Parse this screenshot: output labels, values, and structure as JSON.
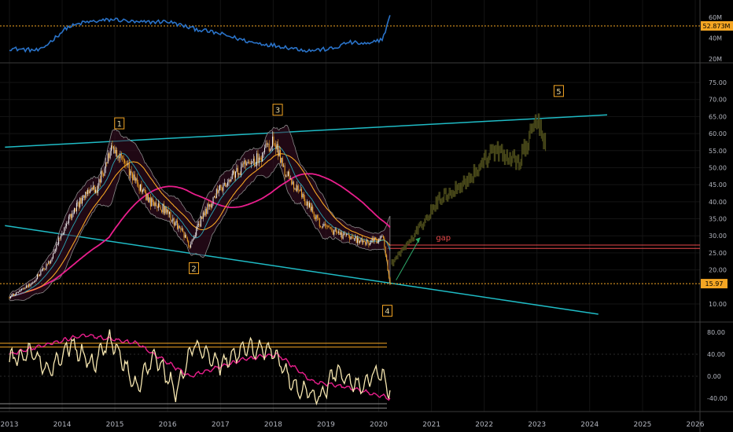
{
  "colors": {
    "background": "#000000",
    "grid": "#141414",
    "axis_text": "#b2b5be",
    "channel": "#1fbcc6",
    "volume": "#2a73c9",
    "candle_up": "#f0f0f0",
    "candle_down": "#f5a623",
    "ma_pink": "#e91e8c",
    "ma_orange": "#f5a623",
    "projection": "#4a4a1a",
    "price_badge": "#f5a623",
    "gap": "#e8494a",
    "rsi_fast": "#f7e7b0",
    "rsi_slow": "#e91e8c",
    "orange_level": "#f5a623"
  },
  "volume_panel": {
    "label_top": "60M",
    "label_mid": "40M",
    "label_low": "20M",
    "badge": "52.873M"
  },
  "price_badge": "15.97",
  "gap_label": "gap",
  "wave_labels": [
    "1",
    "2",
    "3",
    "4",
    "5"
  ],
  "chart_data": {
    "type": "candlestick",
    "x_axis": {
      "type": "date",
      "ticks": [
        "2013",
        "2014",
        "2015",
        "2016",
        "2017",
        "2018",
        "2019",
        "2020",
        "2021",
        "2022",
        "2023",
        "2024",
        "2025",
        "2026"
      ],
      "range": [
        "2013-01-01",
        "2026-01-01"
      ]
    },
    "y_axis": {
      "ticks": [
        "75.00",
        "70.00",
        "65.00",
        "60.00",
        "55.00",
        "50.00",
        "45.00",
        "40.00",
        "35.00",
        "30.00",
        "25.00",
        "20.00",
        "10.00"
      ],
      "range": [
        5,
        77
      ]
    },
    "price_path": [
      [
        "2013-01-01",
        12
      ],
      [
        "2013-06-01",
        16
      ],
      [
        "2013-10-01",
        22
      ],
      [
        "2014-02-01",
        34
      ],
      [
        "2014-06-01",
        42
      ],
      [
        "2014-09-01",
        44
      ],
      [
        "2014-12-01",
        55
      ],
      [
        "2015-03-01",
        52
      ],
      [
        "2015-06-01",
        46
      ],
      [
        "2015-09-01",
        40
      ],
      [
        "2015-12-01",
        38
      ],
      [
        "2016-04-01",
        32
      ],
      [
        "2016-06-01",
        27
      ],
      [
        "2016-09-01",
        36
      ],
      [
        "2017-01-01",
        44
      ],
      [
        "2017-06-01",
        50
      ],
      [
        "2017-10-01",
        53
      ],
      [
        "2018-01-01",
        58
      ],
      [
        "2018-04-01",
        48
      ],
      [
        "2018-08-01",
        41
      ],
      [
        "2018-12-01",
        33
      ],
      [
        "2019-05-01",
        30
      ],
      [
        "2019-10-01",
        28
      ],
      [
        "2020-02-01",
        29
      ],
      [
        "2020-03-20",
        15.97
      ]
    ],
    "projection_path": [
      [
        "2020-04-01",
        22
      ],
      [
        "2020-09-01",
        30
      ],
      [
        "2021-03-01",
        41
      ],
      [
        "2021-09-01",
        46
      ],
      [
        "2022-03-01",
        55
      ],
      [
        "2022-09-01",
        52
      ],
      [
        "2023-01-01",
        64
      ],
      [
        "2023-03-01",
        56
      ]
    ],
    "channel_upper": [
      [
        "2012-12-01",
        56
      ],
      [
        "2024-05-01",
        65.5
      ]
    ],
    "channel_lower": [
      [
        "2012-12-01",
        33
      ],
      [
        "2024-03-01",
        7
      ]
    ],
    "levels": [
      {
        "name": "gap_top",
        "value": 27.3
      },
      {
        "name": "gap_bottom",
        "value": 26.3
      },
      {
        "name": "low",
        "value": 15.97
      }
    ],
    "waves": [
      {
        "label": "1",
        "date": "2015-02-01",
        "value": 63
      },
      {
        "label": "2",
        "date": "2016-07-01",
        "value": 20.5
      },
      {
        "label": "3",
        "date": "2018-02-01",
        "value": 67
      },
      {
        "label": "4",
        "date": "2020-03-01",
        "value": 8
      },
      {
        "label": "5",
        "date": "2023-06-01",
        "value": 72.5
      }
    ],
    "volume": {
      "range": [
        15,
        65
      ],
      "path": [
        [
          "2013-01-01",
          30
        ],
        [
          "2013-08-01",
          28
        ],
        [
          "2014-02-01",
          50
        ],
        [
          "2014-06-01",
          55
        ],
        [
          "2015-01-01",
          58
        ],
        [
          "2015-06-01",
          55
        ],
        [
          "2016-01-01",
          56
        ],
        [
          "2016-06-01",
          50
        ],
        [
          "2017-01-01",
          44
        ],
        [
          "2017-08-01",
          36
        ],
        [
          "2018-03-01",
          32
        ],
        [
          "2018-09-01",
          28
        ],
        [
          "2019-03-01",
          30
        ],
        [
          "2019-06-01",
          36
        ],
        [
          "2019-11-01",
          34
        ],
        [
          "2020-02-01",
          40
        ],
        [
          "2020-03-20",
          62
        ]
      ]
    },
    "oscillator": {
      "ticks": [
        "80.00",
        "40.00",
        "0.00",
        "-40.00"
      ],
      "range": [
        -65,
        90
      ],
      "orange_levels": [
        60,
        53
      ],
      "grey_levels": [
        -50,
        -58
      ],
      "fast_path": [
        [
          "2013-01-01",
          30
        ],
        [
          "2013-06-01",
          45
        ],
        [
          "2013-10-01",
          10
        ],
        [
          "2014-03-01",
          60
        ],
        [
          "2014-08-01",
          20
        ],
        [
          "2014-12-01",
          70
        ],
        [
          "2015-06-01",
          -20
        ],
        [
          "2015-10-01",
          40
        ],
        [
          "2016-03-01",
          -30
        ],
        [
          "2016-07-01",
          60
        ],
        [
          "2017-01-01",
          20
        ],
        [
          "2017-07-01",
          50
        ],
        [
          "2018-01-01",
          45
        ],
        [
          "2018-06-01",
          -20
        ],
        [
          "2018-12-01",
          -40
        ],
        [
          "2019-03-01",
          10
        ],
        [
          "2019-09-01",
          -20
        ],
        [
          "2020-01-01",
          10
        ],
        [
          "2020-03-20",
          -30
        ]
      ],
      "slow_path": [
        [
          "2013-01-01",
          40
        ],
        [
          "2014-06-01",
          75
        ],
        [
          "2015-06-01",
          60
        ],
        [
          "2016-06-01",
          0
        ],
        [
          "2017-06-01",
          30
        ],
        [
          "2018-02-01",
          40
        ],
        [
          "2018-10-01",
          -10
        ],
        [
          "2019-06-01",
          -20
        ],
        [
          "2020-03-20",
          -40
        ]
      ]
    }
  }
}
